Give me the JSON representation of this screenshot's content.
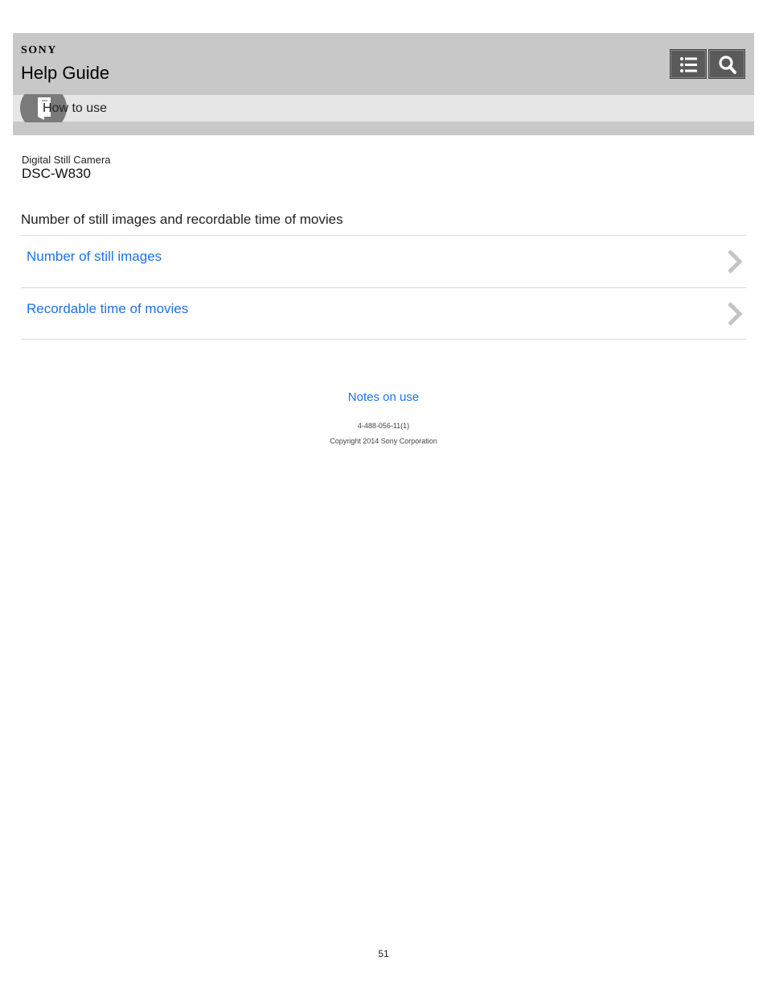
{
  "header": {
    "brand": "SONY",
    "title": "Help Guide",
    "toc_button_icon": "list-icon",
    "search_button_icon": "search-icon"
  },
  "breadcrumb": {
    "label": "How to use",
    "icon": "book-icon"
  },
  "product": {
    "line": "Digital Still Camera",
    "model": "DSC-W830"
  },
  "main": {
    "heading": "Number of still images and recordable time of movies",
    "items": [
      {
        "label": "Number of still images"
      },
      {
        "label": "Recordable time of movies"
      }
    ]
  },
  "footer": {
    "notes_link": "Notes on use",
    "doc_id": "4-488-056-11(1)",
    "copyright": "Copyright 2014 Sony Corporation"
  },
  "page_number": "51",
  "colors": {
    "link": "#1a73e8",
    "header_bg": "#c8c8c8",
    "breadcrumb_bg": "#e6e6e6",
    "button_bg": "#5a5a5a"
  }
}
